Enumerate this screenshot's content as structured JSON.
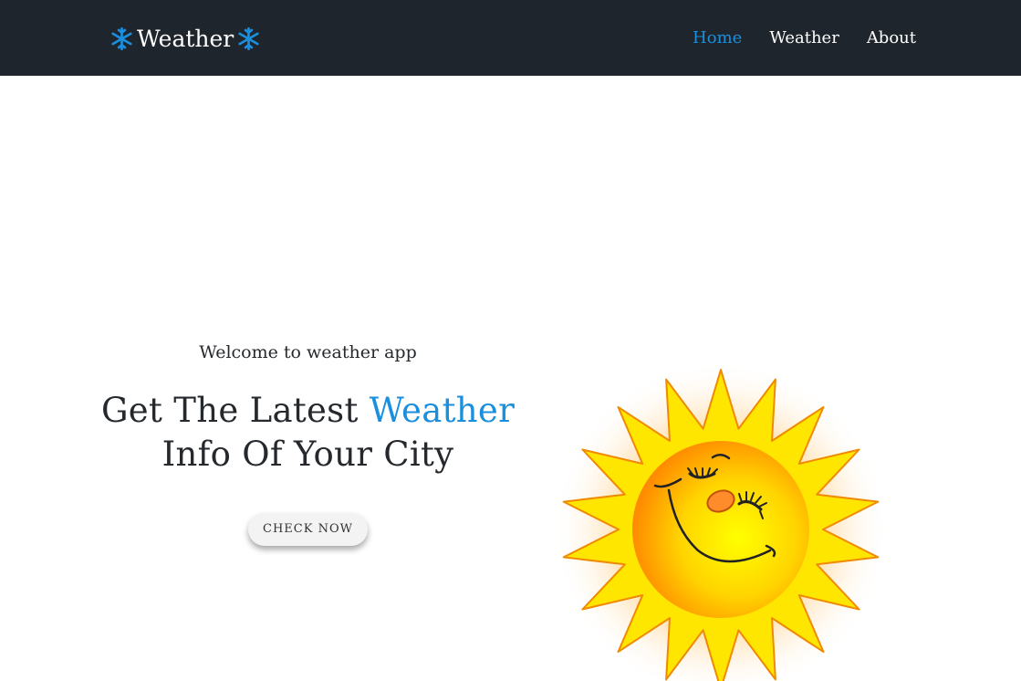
{
  "nav": {
    "brand_label": "Weather",
    "brand_icon": "snowflake-icon",
    "links": [
      {
        "label": "Home",
        "active": true
      },
      {
        "label": "Weather",
        "active": false
      },
      {
        "label": "About",
        "active": false
      }
    ]
  },
  "hero": {
    "welcome": "Welcome to weather app",
    "headline_part1": "Get The Latest ",
    "headline_accent": "Weather",
    "headline_part2": "Info Of Your City",
    "button_label": "CHECK NOW",
    "image_icon": "smiling-sun-icon"
  },
  "colors": {
    "nav_bg": "#1f252d",
    "accent": "#1a8fde",
    "text": "#25292e"
  }
}
